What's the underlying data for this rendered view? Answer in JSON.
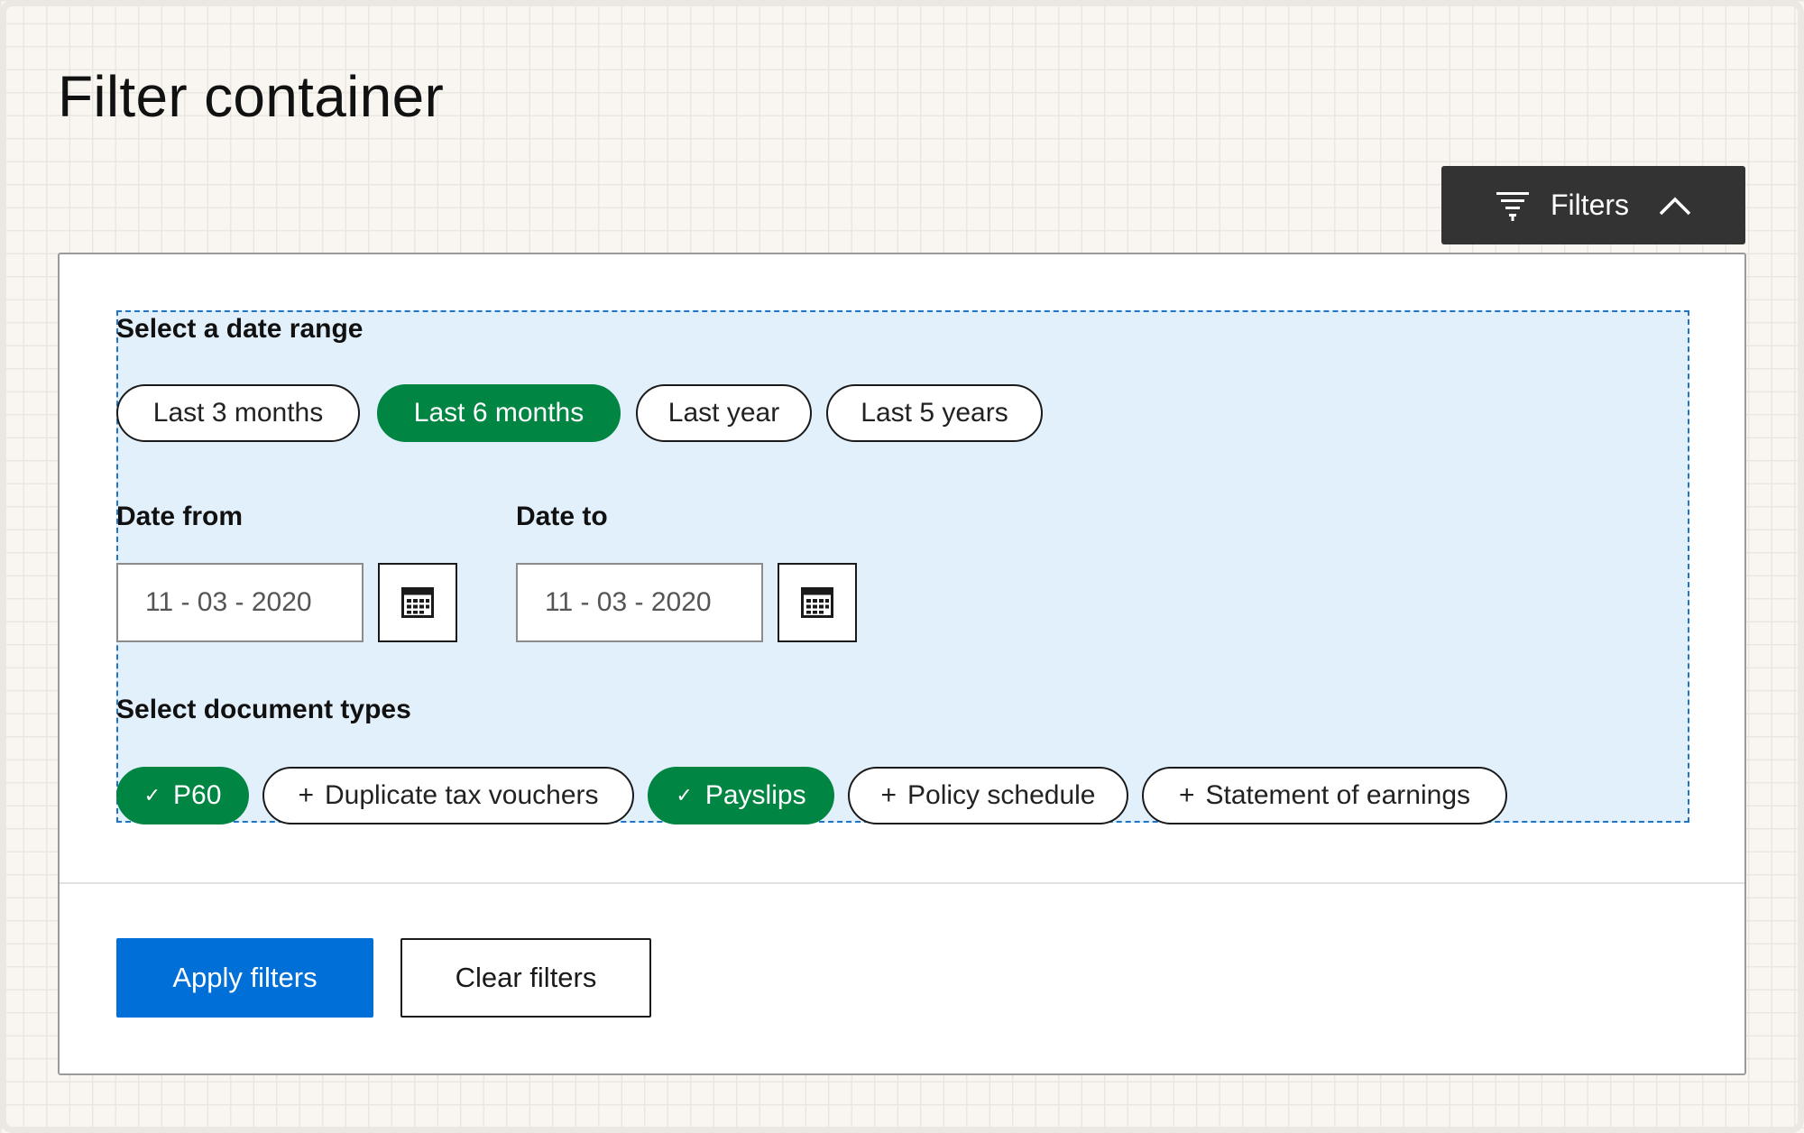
{
  "page": {
    "title": "Filter container"
  },
  "toggle": {
    "label": "Filters"
  },
  "date_range": {
    "label": "Select a date range",
    "options": [
      {
        "label": "Last 3 months",
        "selected": false
      },
      {
        "label": "Last 6 months",
        "selected": true
      },
      {
        "label": "Last year",
        "selected": false
      },
      {
        "label": "Last 5 years",
        "selected": false
      }
    ]
  },
  "date_from": {
    "label": "Date from",
    "value": "11 - 03 - 2020"
  },
  "date_to": {
    "label": "Date to",
    "value": "11 - 03 - 2020"
  },
  "document_types": {
    "label": "Select document types",
    "options": [
      {
        "label": "P60",
        "selected": true
      },
      {
        "label": "Duplicate tax vouchers",
        "selected": false
      },
      {
        "label": "Payslips",
        "selected": true
      },
      {
        "label": "Policy schedule",
        "selected": false
      },
      {
        "label": "Statement of earnings",
        "selected": false
      }
    ]
  },
  "actions": {
    "apply_label": "Apply filters",
    "clear_label": "Clear filters"
  },
  "colors": {
    "selected_green": "#008542",
    "primary_blue": "#0070d8",
    "toggle_dark": "#333333",
    "body_highlight": "#e2f0fb"
  }
}
